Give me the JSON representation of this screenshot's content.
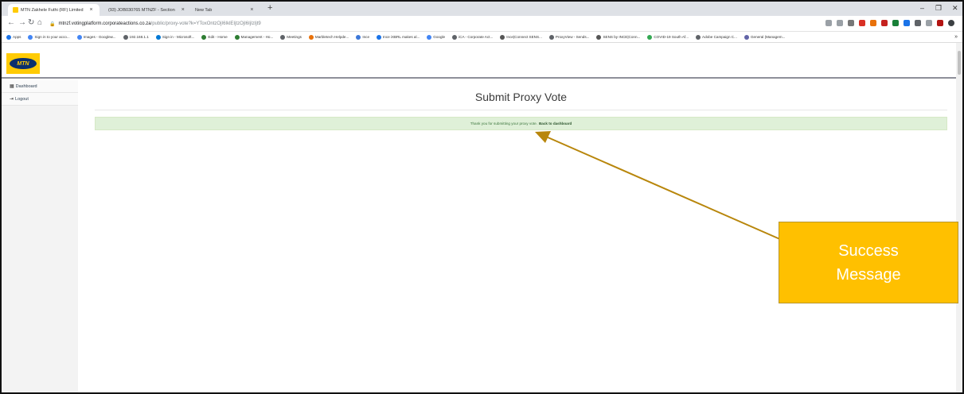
{
  "browser": {
    "tabs": [
      {
        "title": "MTN Zakhele Futhi (RF) Limited",
        "active": true,
        "color": "#ffcb05"
      },
      {
        "title": "(93) JOB030765 MTNZF - Section",
        "active": false,
        "color": "#6a8fd1"
      },
      {
        "title": "New Tab",
        "active": false,
        "color": "#ffffff"
      }
    ],
    "new_tab_symbol": "+",
    "url_host": "mtnzf.votingplatform.corporateactions.co.za",
    "url_path": "/public/proxy-vote?k=YToxOntzOjI6IklEIjtzOjI6IjIzIjt9",
    "bookmarks": [
      "Apps",
      "Sign in to your acco...",
      "Images - Googlew...",
      "192.168.1.1",
      "Sign in - Microsoft...",
      "Edit - Home",
      "Management - Ho...",
      "Meetings",
      "Marbletech Helpde...",
      "Ince",
      "Ince iXBRL makes al...",
      "Google",
      "iCA - Corporate Act...",
      "Ince|Connect SENS...",
      "ProxyView - Sends...",
      "SENS by INCE|Conn...",
      "COVID-19 South Af...",
      "Adobe Campaign C...",
      "General (Managem..."
    ],
    "bookmarks_more": "»"
  },
  "app": {
    "logo_text": "MTN",
    "sidebar": [
      {
        "label": "Dashboard",
        "icon": "grid-icon"
      },
      {
        "label": "Logout",
        "icon": "logout-icon"
      }
    ],
    "page_title": "Submit Proxy Vote",
    "alert_text": "Thank you for submitting your proxy vote.",
    "alert_link": "Back to dashboard"
  },
  "annotation": {
    "line1": "Success",
    "line2": "Message",
    "color": "#ffc000",
    "arrow_color": "#b8860b"
  }
}
